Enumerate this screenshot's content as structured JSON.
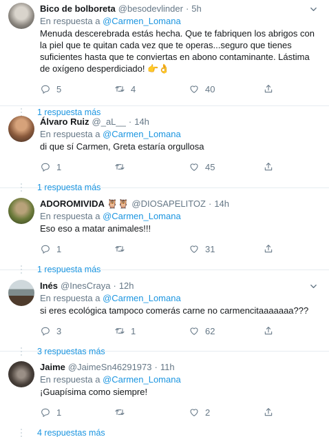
{
  "tweets": [
    {
      "name": "Bico de bolboreta",
      "handle": "@besodevlinder",
      "time": "5h",
      "reply_prefix": "En respuesta a ",
      "reply_mention": "@Carmen_Lomana",
      "text": "Menuda descerebrada estás hecha. Que te fabriquen los abrigos con la piel que te quitan cada vez que te operas...seguro que tienes suficientes hasta que te conviertas en abono contaminante. Lástima de oxígeno desperdiciado! 👉👌",
      "replies": "5",
      "retweets": "4",
      "likes": "40",
      "more": "1 respuesta más"
    },
    {
      "name": "Álvaro Ruiz",
      "handle": "@_aL__",
      "time": "14h",
      "reply_prefix": "En respuesta a ",
      "reply_mention": "@Carmen_Lomana",
      "text": "di que sí Carmen, Greta estaría orgullosa",
      "replies": "1",
      "retweets": "",
      "likes": "45",
      "more": "1 respuesta más"
    },
    {
      "name": "ADOROMIVIDA 🦉🦉",
      "handle": "@DIOSAPELITOZ",
      "time": "14h",
      "reply_prefix": "En respuesta a ",
      "reply_mention": "@Carmen_Lomana",
      "text": "Eso eso a matar animales!!!",
      "replies": "1",
      "retweets": "",
      "likes": "31",
      "more": "1 respuesta más"
    },
    {
      "name": "Inés",
      "handle": "@InesCraya",
      "time": "12h",
      "reply_prefix": "En respuesta a ",
      "reply_mention": "@Carmen_Lomana",
      "text": "si eres ecológica tampoco comerás carne no carmencitaaaaaaa???",
      "replies": "3",
      "retweets": "1",
      "likes": "62",
      "more": "3 respuestas más"
    },
    {
      "name": "Jaime",
      "handle": "@JaimeSn46291973",
      "time": "11h",
      "reply_prefix": "En respuesta a ",
      "reply_mention": "@Carmen_Lomana",
      "text": "¡Guapísima como siempre!",
      "replies": "1",
      "retweets": "",
      "likes": "2",
      "more": "4 respuestas más"
    }
  ],
  "separator": "·",
  "icons": {
    "reply": "reply-icon",
    "retweet": "retweet-icon",
    "like": "heart-icon",
    "share": "share-icon",
    "caret": "chevron-down-icon"
  },
  "colors": {
    "link": "#1b95e0",
    "muted": "#657786",
    "text": "#14171a",
    "border": "#e6ecf0"
  }
}
